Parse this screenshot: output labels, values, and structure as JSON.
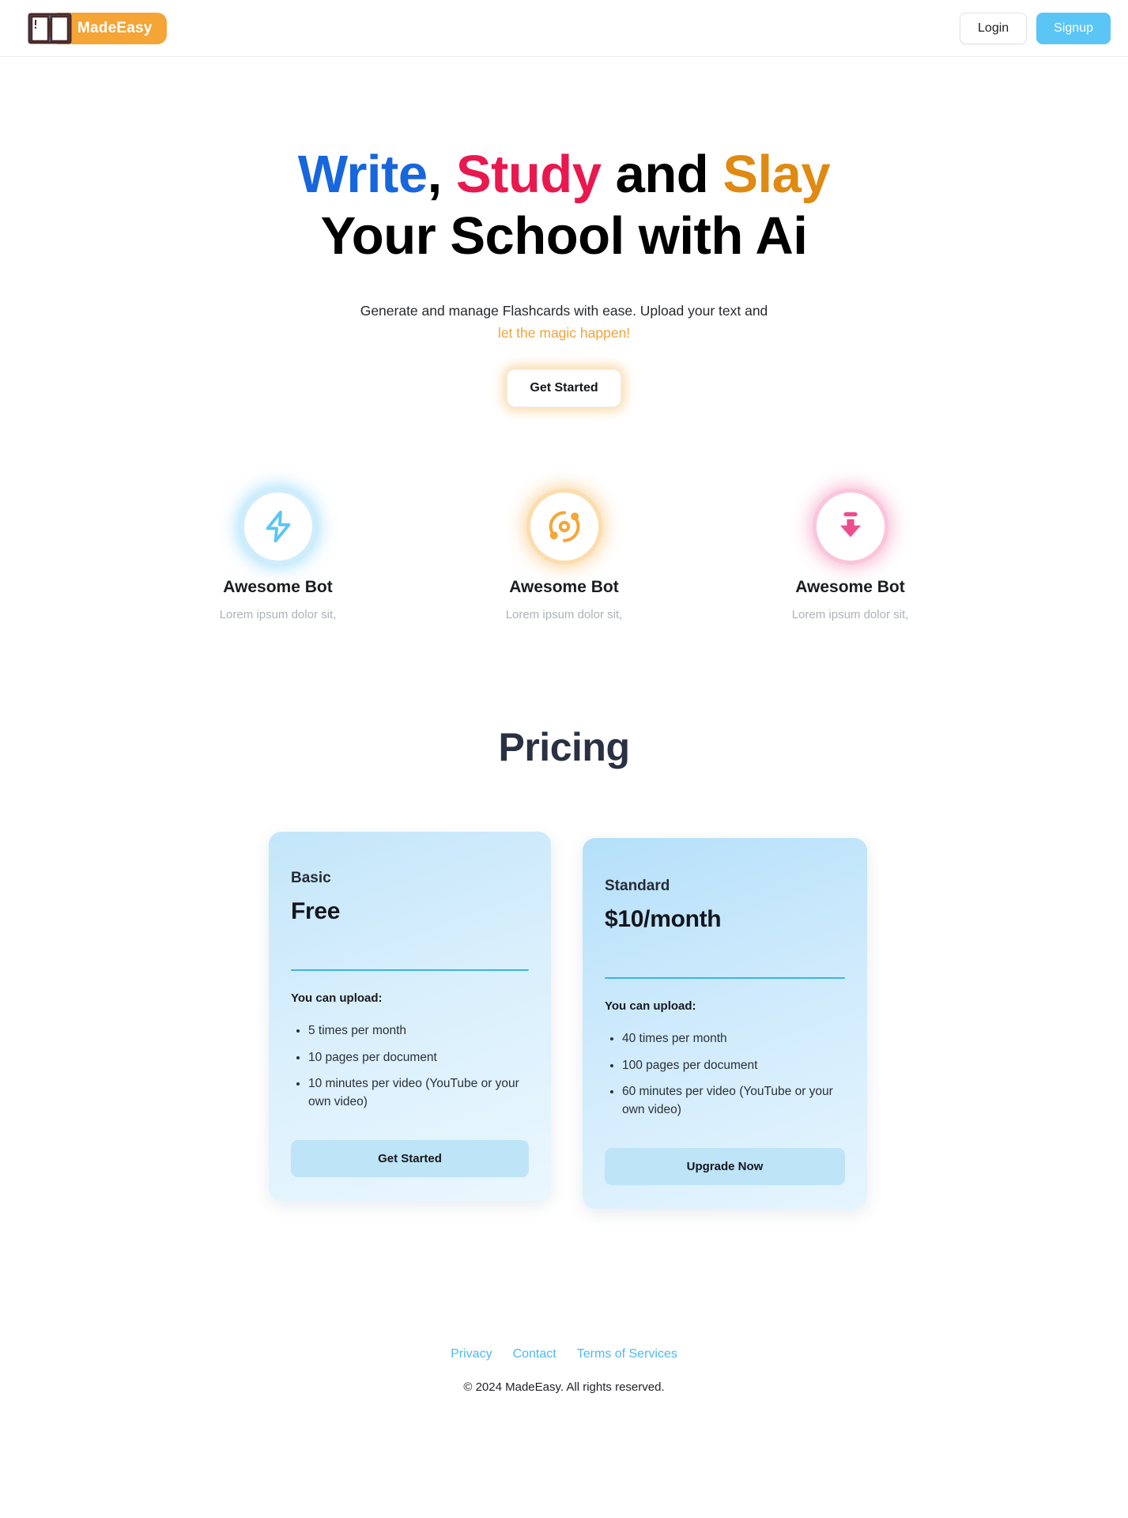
{
  "navbar": {
    "brand_name": "MadeEasy",
    "brand_icon": "open-book-icon",
    "login_label": "Login",
    "signup_label": "Signup",
    "signup_color": "#5BC5F5"
  },
  "hero": {
    "headline": {
      "write": "Write",
      "comma": ",",
      "study": "Study",
      "and": "and",
      "slay": "Slay",
      "line2": "Your School with Ai",
      "colors": {
        "write": "#1766DC",
        "study": "#E8194F",
        "and": "#000000",
        "slay": "#DF8A12"
      }
    },
    "subtitle_line1": "Generate and manage Flashcards with ease. Upload your text and",
    "subtitle_magic": "let the magic happen!",
    "magic_color": "#F0A33B",
    "cta_label": "Get Started"
  },
  "features": [
    {
      "icon": "lightning-bolt-icon",
      "icon_color": "#5BC5F5",
      "title": "Awesome Bot",
      "description": "Lorem ipsum dolor sit,"
    },
    {
      "icon": "orbit-icon",
      "icon_color": "#F5A636",
      "title": "Awesome Bot",
      "description": "Lorem ipsum dolor sit,"
    },
    {
      "icon": "download-arrow-icon",
      "icon_color": "#EC4E8D",
      "title": "Awesome Bot",
      "description": "Lorem ipsum dolor sit,"
    }
  ],
  "pricing": {
    "heading": "Pricing",
    "heading_color": "#2A3142",
    "plans": [
      {
        "name": "Basic",
        "price": "Free",
        "upload_label": "You can upload:",
        "features": [
          "5 times per month",
          "10 pages per document",
          "10 minutes per video (YouTube or your own video)"
        ],
        "button_label": "Get Started"
      },
      {
        "name": "Standard",
        "price": "$10/month",
        "upload_label": "You can upload:",
        "features": [
          "40 times per month",
          "100 pages per document",
          "60 minutes per video (YouTube or your own video)"
        ],
        "button_label": "Upgrade Now"
      }
    ]
  },
  "footer": {
    "links": [
      {
        "label": "Privacy"
      },
      {
        "label": "Contact"
      },
      {
        "label": "Terms of Services"
      }
    ],
    "link_color": "#4FB8F0",
    "copyright": "© 2024 MadeEasy. All rights reserved."
  }
}
